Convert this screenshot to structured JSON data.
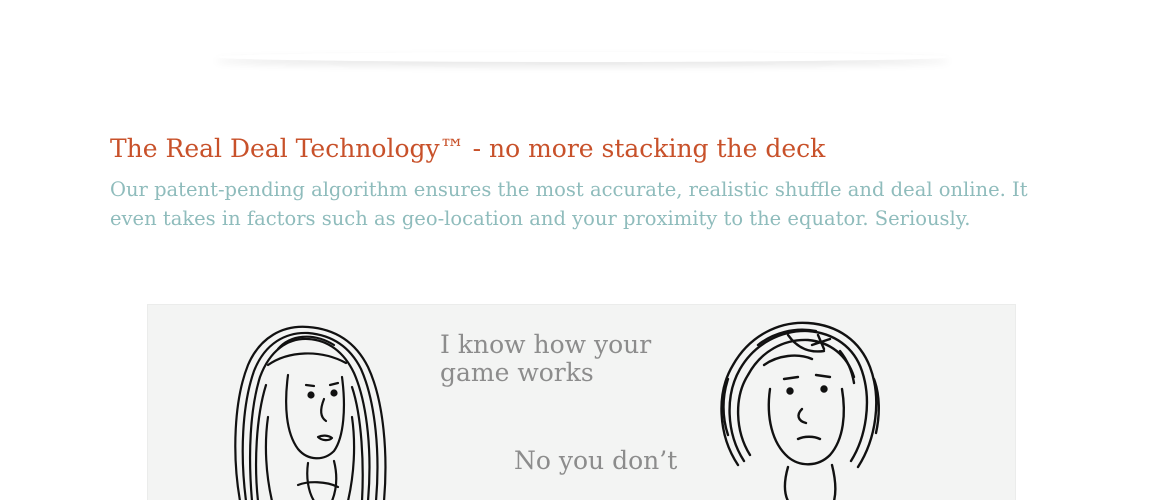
{
  "feature": {
    "heading": "The Real Deal Technology™ - no more stacking the deck",
    "description": "Our patent-pending algorithm ensures the most accurate, realistic shuffle and deal online. It even takes in factors such as geo-location and your proximity to the equator. Seriously.",
    "heading_color": "#c8512a",
    "description_color": "#8fbcbc"
  },
  "comic": {
    "speech_1": "I know how your game works",
    "speech_2": "No you don’t",
    "background_color": "#f3f4f3"
  }
}
